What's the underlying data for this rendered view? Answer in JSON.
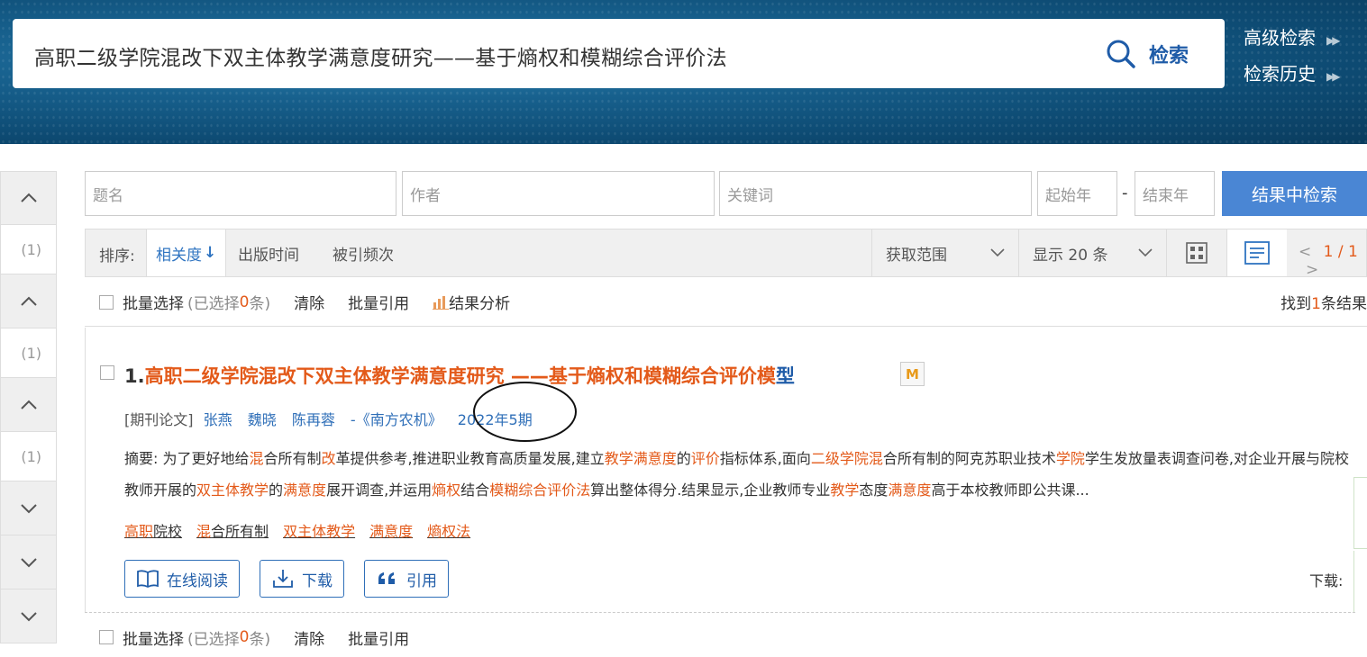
{
  "header": {
    "query": "高职二级学院混改下双主体教学满意度研究——基于熵权和模糊综合评价法",
    "search_label": "检索",
    "advanced_search": "高级检索",
    "search_history": "检索历史"
  },
  "rail": {
    "counts": [
      "(1)",
      "(1)",
      "(1)"
    ]
  },
  "filters": {
    "title_placeholder": "题名",
    "author_placeholder": "作者",
    "keyword_placeholder": "关键词",
    "start_year_placeholder": "起始年",
    "end_year_placeholder": "结束年",
    "dash": "-",
    "search_in_results": "结果中检索"
  },
  "sortbar": {
    "label": "排序:",
    "relevance": "相关度",
    "relevance_arrow": "↓",
    "pub_time": "出版时间",
    "cited": "被引频次",
    "scope": "获取范围",
    "page_size": "显示 20 条",
    "pager_prev": "<",
    "pager_current": "1",
    "pager_sep": "/",
    "pager_total": "1",
    "pager_next": ">"
  },
  "batch": {
    "select_all": "批量选择",
    "selected_prefix": "(已选择",
    "selected_count": "0",
    "selected_suffix": "条)",
    "clear": "清除",
    "batch_cite": "批量引用",
    "analysis": "结果分析",
    "found_prefix": "找到",
    "found_count": "1",
    "found_suffix": "条结果"
  },
  "result": {
    "number": "1.",
    "title_main": "高职二级学院混改下双主体教学满意度研究 ——基于熵权和模糊综合评价模",
    "title_tail": "型",
    "badge": "M",
    "type": "[期刊论文]",
    "authors": [
      "张燕",
      "魏晓",
      "陈再蓉"
    ],
    "journal": "-《南方农机》",
    "issue": "2022年5期",
    "abstract_label": "摘要:",
    "abstract_parts": [
      {
        "t": " 为了更好地给",
        "h": false
      },
      {
        "t": "混",
        "h": true
      },
      {
        "t": "合所有制",
        "h": false
      },
      {
        "t": "改",
        "h": true
      },
      {
        "t": "革提供参考,推进职业教育高质量发展,建立",
        "h": false
      },
      {
        "t": "教学满意度",
        "h": true
      },
      {
        "t": "的",
        "h": false
      },
      {
        "t": "评价",
        "h": true
      },
      {
        "t": "指标体系,面向",
        "h": false
      },
      {
        "t": "二级学院混",
        "h": true
      },
      {
        "t": "合所有制的阿克苏职业技术",
        "h": false
      },
      {
        "t": "学院",
        "h": true
      },
      {
        "t": "学生发放量表调查问卷,对企业开展与院校教师开展的",
        "h": false
      },
      {
        "t": "双主体教学",
        "h": true
      },
      {
        "t": "的",
        "h": false
      },
      {
        "t": "满意度",
        "h": true
      },
      {
        "t": "展开调查,并运用",
        "h": false
      },
      {
        "t": "熵权",
        "h": true
      },
      {
        "t": "结合",
        "h": false
      },
      {
        "t": "模糊综合评价法",
        "h": true
      },
      {
        "t": "算出整体得分.结果显示,企业教师专业",
        "h": false
      },
      {
        "t": "教学",
        "h": true
      },
      {
        "t": "态度",
        "h": false
      },
      {
        "t": "满意度",
        "h": true
      },
      {
        "t": "高于本校教师即公共课...",
        "h": false
      }
    ],
    "keywords": [
      [
        {
          "t": "高职",
          "h": true
        },
        {
          "t": "院校",
          "h": false
        }
      ],
      [
        {
          "t": "混",
          "h": true
        },
        {
          "t": "合所有制",
          "h": false
        }
      ],
      [
        {
          "t": "双主体教学",
          "h": true
        }
      ],
      [
        {
          "t": "满意度",
          "h": true
        }
      ],
      [
        {
          "t": "熵权法",
          "h": true
        }
      ]
    ],
    "read_online": "在线阅读",
    "download": "下载",
    "cite": "引用",
    "download_label": "下载:"
  },
  "colors": {
    "highlight": "#e35a1a",
    "link": "#2f6fb8",
    "primary": "#4a86d4"
  }
}
